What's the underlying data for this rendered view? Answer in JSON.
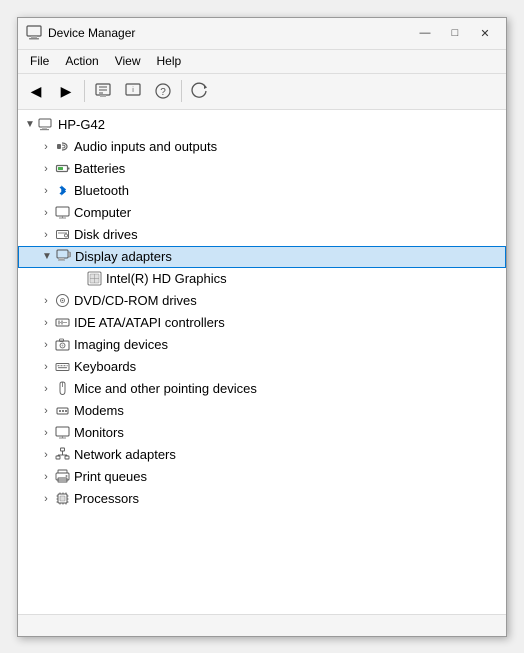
{
  "window": {
    "title": "Device Manager",
    "icon": "device-manager"
  },
  "titlebar": {
    "minimize_label": "—",
    "maximize_label": "□",
    "close_label": "✕"
  },
  "menu": {
    "items": [
      {
        "id": "file",
        "label": "File"
      },
      {
        "id": "action",
        "label": "Action"
      },
      {
        "id": "view",
        "label": "View"
      },
      {
        "id": "help",
        "label": "Help"
      }
    ]
  },
  "tree": {
    "root": {
      "label": "HP-G42",
      "icon": "computer"
    },
    "items": [
      {
        "id": "audio",
        "label": "Audio inputs and outputs",
        "icon": "audio",
        "indent": 1,
        "expanded": false
      },
      {
        "id": "batteries",
        "label": "Batteries",
        "icon": "battery",
        "indent": 1,
        "expanded": false
      },
      {
        "id": "bluetooth",
        "label": "Bluetooth",
        "icon": "bluetooth",
        "indent": 1,
        "expanded": false
      },
      {
        "id": "computer",
        "label": "Computer",
        "icon": "monitor",
        "indent": 1,
        "expanded": false
      },
      {
        "id": "disk",
        "label": "Disk drives",
        "icon": "disk",
        "indent": 1,
        "expanded": false
      },
      {
        "id": "display",
        "label": "Display adapters",
        "icon": "display",
        "indent": 1,
        "expanded": true,
        "selected": true
      },
      {
        "id": "intel",
        "label": "Intel(R) HD Graphics",
        "icon": "intel",
        "indent": 2,
        "expanded": false
      },
      {
        "id": "dvd",
        "label": "DVD/CD-ROM drives",
        "icon": "dvd",
        "indent": 1,
        "expanded": false
      },
      {
        "id": "ide",
        "label": "IDE ATA/ATAPI controllers",
        "icon": "ide",
        "indent": 1,
        "expanded": false
      },
      {
        "id": "imaging",
        "label": "Imaging devices",
        "icon": "imaging",
        "indent": 1,
        "expanded": false
      },
      {
        "id": "keyboards",
        "label": "Keyboards",
        "icon": "keyboard",
        "indent": 1,
        "expanded": false
      },
      {
        "id": "mice",
        "label": "Mice and other pointing devices",
        "icon": "mouse",
        "indent": 1,
        "expanded": false
      },
      {
        "id": "modems",
        "label": "Modems",
        "icon": "modem",
        "indent": 1,
        "expanded": false
      },
      {
        "id": "monitors",
        "label": "Monitors",
        "icon": "monitor",
        "indent": 1,
        "expanded": false
      },
      {
        "id": "network",
        "label": "Network adapters",
        "icon": "netadapter",
        "indent": 1,
        "expanded": false
      },
      {
        "id": "print",
        "label": "Print queues",
        "icon": "print",
        "indent": 1,
        "expanded": false
      },
      {
        "id": "processors",
        "label": "Processors",
        "icon": "processor",
        "indent": 1,
        "expanded": false
      }
    ]
  },
  "colors": {
    "selected_bg": "#cce4f7",
    "selected_border": "#0078d7",
    "hover_bg": "#e8f0fe"
  }
}
